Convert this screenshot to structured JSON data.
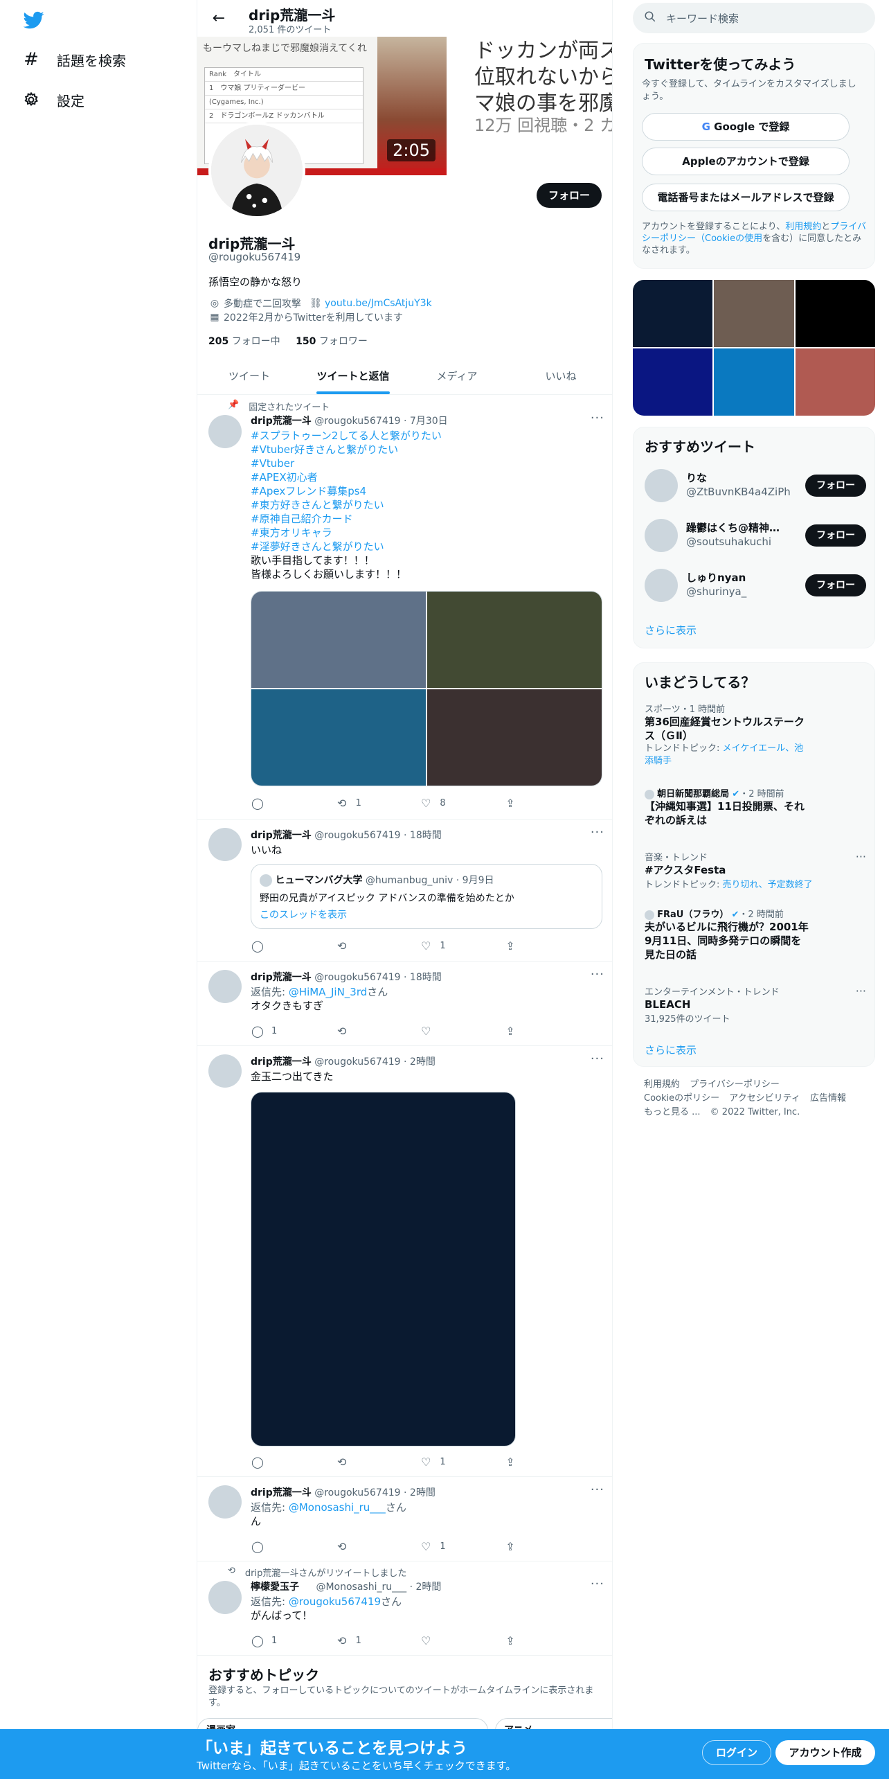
{
  "nav": {
    "explore": "話題を検索",
    "settings": "設定"
  },
  "header": {
    "name": "drip荒瀧一斗",
    "tweet_count": "2,051 件のツイート"
  },
  "banner": {
    "top_text": "もーウマしねまじで邪魔娘消えてくれ",
    "table_rows": [
      "Rank　タイトル",
      "1　ウマ娘 プリティーダービー",
      "(Cygames, Inc.)",
      "2　ドラゴンボールZ ドッカンバトル"
    ],
    "duration": "2:05",
    "title_line1": "ドッカンが両ス",
    "title_line2": "位取れないから",
    "title_line3": "マ娘の事を邪魔",
    "subtitle": "12万 回視聴・2 カ"
  },
  "profile": {
    "follow_button": "フォロー",
    "name": "drip荒瀧一斗",
    "handle": "@rougoku567419",
    "bio": "孫悟空の静かな怒り",
    "location": "多動症で二回攻撃",
    "link": "youtu.be/JmCsAtjuY3k",
    "joined": "2022年2月からTwitterを利用しています",
    "following_count": "205",
    "following_label": "フォロー中",
    "followers_count": "150",
    "followers_label": "フォロワー"
  },
  "tabs": [
    {
      "label": "ツイート"
    },
    {
      "label": "ツイートと返信"
    },
    {
      "label": "メディア"
    },
    {
      "label": "いいね"
    }
  ],
  "tweets": [
    {
      "pinned_label": "固定されたツイート",
      "name": "drip荒瀧一斗",
      "handle": "@rougoku567419",
      "time": "7月30日",
      "hashtags": [
        "#スプラトゥーン2してる人と繋がりたい",
        "#Vtuber好きさんと繋がりたい",
        "#Vtuber",
        "#APEX初心者",
        "#Apexフレンド募集ps4",
        "#東方好きさんと繋がりたい",
        "#原神自己紹介カード",
        "#東方オリキャラ",
        "#淫夢好きさんと繋がりたい"
      ],
      "text_lines": [
        "歌い手目指してます！！！",
        "皆様よろしくお願いします！！！"
      ],
      "image_colors": [
        "#5f7188",
        "#424a33",
        "#1e6287",
        "#3b3030"
      ],
      "retweets": "1",
      "likes": "8"
    },
    {
      "name": "drip荒瀧一斗",
      "handle": "@rougoku567419",
      "time": "18時間",
      "text": "いいね",
      "quote_name": "ヒューマンバグ大学",
      "quote_handle": "@humanbug_univ",
      "quote_time": "9月9日",
      "quote_text": "野田の兄貴がアイスピック アドバンスの準備を始めたとか",
      "quote_link": "このスレッドを表示",
      "likes": "1"
    },
    {
      "name": "drip荒瀧一斗",
      "handle": "@rougoku567419",
      "time": "18時間",
      "reply_prefix": "返信先: ",
      "reply_to": "@HiMA_JiN_3rd",
      "reply_suffix": "さん",
      "text": "オタクきもすぎ",
      "replies": "1"
    },
    {
      "name": "drip荒瀧一斗",
      "handle": "@rougoku567419",
      "time": "2時間",
      "text": "金玉二つ出てきた",
      "image_color": "#0a1a30",
      "likes": "1"
    },
    {
      "name": "drip荒瀧一斗",
      "handle": "@rougoku567419",
      "time": "2時間",
      "reply_prefix": "返信先: ",
      "reply_to": "@Monosashi_ru___",
      "reply_suffix": "さん",
      "text": "ん",
      "likes": "1"
    },
    {
      "retweet_label": "drip荒瀧一斗さんがリツイートしました",
      "name": "檸檬愛玉子",
      "handle": "@Monosashi_ru___",
      "time": "2時間",
      "reply_prefix": "返信先: ",
      "reply_to": "@rougoku567419",
      "reply_suffix": "さん",
      "text": "がんばって！",
      "replies": "1",
      "retweets": "1"
    }
  ],
  "topics": {
    "title": "おすすめトピック",
    "desc": "登録すると、フォローしているトピックについてのツイートがホームタイムラインに表示されます。",
    "chip1": "漫画家",
    "chip2": "アニメ"
  },
  "sidebar": {
    "search_placeholder": "キーワード検索",
    "signup_title": "Twitterを使ってみよう",
    "signup_desc": "今すぐ登録して、タイムラインをカスタマイズしましょう。",
    "google_btn": "Google で登録",
    "apple_btn": "Appleのアカウントで登録",
    "phone_btn": "電話番号またはメールアドレスで登録",
    "terms_1": "アカウントを登録することにより、",
    "terms_link1": "利用規約",
    "terms_2": "と",
    "terms_link2": "プライバシーポリシー（Cookieの使用",
    "terms_3": "を含む）に同意したとみなされます。",
    "media_colors": [
      "#0a1a33",
      "#6e5d52",
      "#000000",
      "#0a1682",
      "#0a79c0",
      "#b05a52"
    ],
    "who_title": "おすすめツイート",
    "who": [
      {
        "name": "りな",
        "handle": "@ZtBuvnKB4a4ZiPh",
        "button": "フォロー"
      },
      {
        "name": "躁鬱はくち@精神疾...",
        "handle": "@soutsuhakuchi",
        "button": "フォロー"
      },
      {
        "name": "しゅりnyan",
        "handle": "@shurinya_",
        "button": "フォロー"
      }
    ],
    "show_more": "さらに表示",
    "trends_title": "いまどうしてる？",
    "trends": [
      {
        "context": "スポーツ・1 時間前",
        "title": "第36回産経賞セントウルステークス（ＧⅡ）",
        "topics_label": "トレンドトピック: ",
        "topics": "メイケイエール、池添騎手"
      },
      {
        "account": "朝日新聞那覇総局",
        "time": "・2 時間前",
        "title": "【沖縄知事選】11日投開票、それぞれの訴えは"
      },
      {
        "context": "音楽・トレンド",
        "title": "#アクスタFesta",
        "topics_label": "トレンドトピック: ",
        "topics": "売り切れ、予定数終了"
      },
      {
        "account": "FRaU（フラウ）",
        "time": "・2 時間前",
        "title": "夫がいるビルに飛行機が？2001年9月11日、同時多発テロの瞬間を見た日の話"
      },
      {
        "context": "エンターテインメント・トレンド",
        "title": "BLEACH",
        "count": "31,925件のツイート"
      }
    ],
    "footer": [
      "利用規約",
      "プライバシーポリシー",
      "Cookieのポリシー",
      "アクセシビリティ",
      "広告情報",
      "もっと見る ...",
      "© 2022 Twitter, Inc."
    ]
  },
  "bottom_bar": {
    "title": "「いま」起きていることを見つけよう",
    "subtitle": "Twitterなら、「いま」起きていることをいち早くチェックできます。",
    "login": "ログイン",
    "signup": "アカウント作成"
  },
  "colors": {
    "accent": "#1d9bf0",
    "text": "#0f1419",
    "muted": "#536471"
  }
}
